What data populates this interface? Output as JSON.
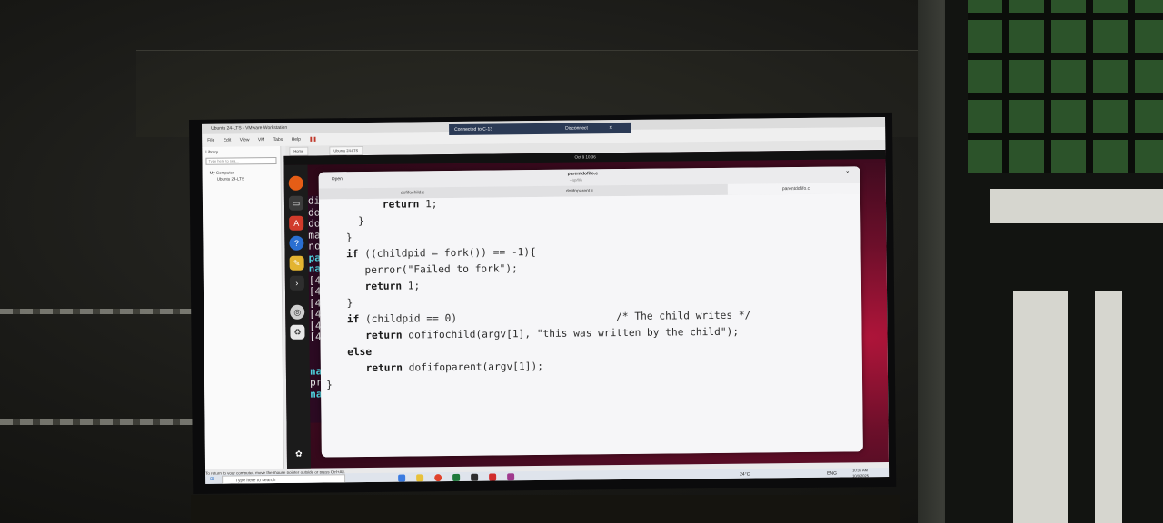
{
  "vmware": {
    "title": "Ubuntu 24-LTS - VMware Workstation",
    "menu": [
      "File",
      "Edit",
      "View",
      "VM",
      "Tabs",
      "Help"
    ],
    "tabs": [
      "Home",
      "Ubuntu 24-LTS"
    ],
    "library": {
      "header": "Library",
      "search_placeholder": "Type here to sea...",
      "items": [
        "My Computer",
        "Ubuntu 24-LTS"
      ]
    }
  },
  "remote_bar": {
    "connection": "Connected to C-13",
    "disconnect_label": "Disconnect"
  },
  "ubuntu": {
    "clock": "Oct 9  10:36",
    "terminal_lines": [
      {
        "text": "dif",
        "style": "plain"
      },
      {
        "text": "dof",
        "style": "plain"
      },
      {
        "text": "dof",
        "style": "plain"
      },
      {
        "text": "mak",
        "style": "plain"
      },
      {
        "text": "non",
        "style": "plain"
      },
      {
        "text": "par",
        "style": "cyan"
      },
      {
        "text": "nad",
        "style": "cyan"
      },
      {
        "text": "[48",
        "style": "plain"
      },
      {
        "text": "[48",
        "style": "plain"
      },
      {
        "text": "[48",
        "style": "plain"
      },
      {
        "text": "[48",
        "style": "plain"
      },
      {
        "text": "[48",
        "style": "plain"
      },
      {
        "text": "[48",
        "style": "plain"
      },
      {
        "text": "",
        "style": "plain"
      },
      {
        "text": "",
        "style": "plain"
      },
      {
        "text": "nad",
        "style": "cyan"
      },
      {
        "text": "prw",
        "style": "plain"
      },
      {
        "text": "nad",
        "style": "cyan"
      }
    ]
  },
  "gedit": {
    "open_label": "Open",
    "file_title": "parentdofifo.c",
    "file_path": "~/sp/fifo",
    "tabs": [
      "dofifochild.c",
      "dofifoparent.c",
      "parentdofifo.c"
    ],
    "code_lines": [
      "        return 1;",
      "    }",
      "  }",
      "  if ((childpid = fork()) == -1){",
      "     perror(\"Failed to fork\");",
      "     return 1;",
      "  }",
      "  if (childpid == 0)                          /* The child writes */",
      "     return dofifochild(argv[1], \"this was written by the child\");",
      "  else",
      "     return dofifoparent(argv[1]);",
      "}"
    ]
  },
  "windows": {
    "status_message": "To return to your computer, move the mouse pointer outside or press Ctrl+Alt.",
    "search_placeholder": "Type here to search",
    "weather": "24°C",
    "lang": "ENG",
    "time": "10:36 AM",
    "date": "10/9/2025"
  }
}
